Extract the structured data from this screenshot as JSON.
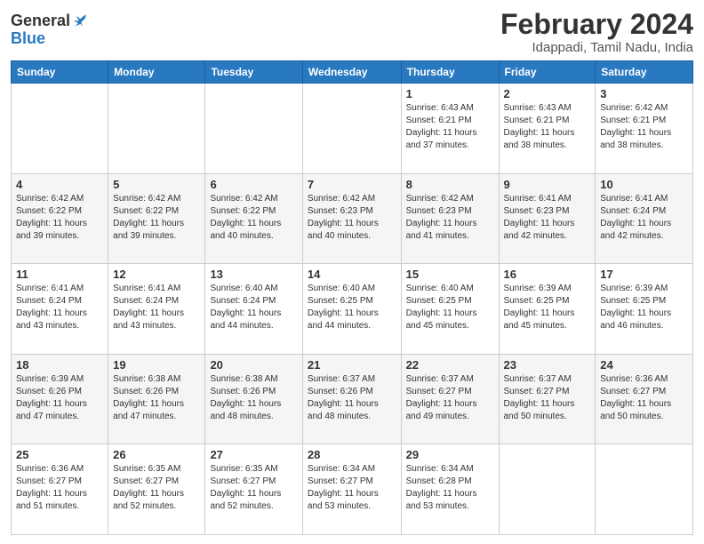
{
  "header": {
    "logo_line1": "General",
    "logo_line2": "Blue",
    "title": "February 2024",
    "subtitle": "Idappadi, Tamil Nadu, India"
  },
  "days_of_week": [
    "Sunday",
    "Monday",
    "Tuesday",
    "Wednesday",
    "Thursday",
    "Friday",
    "Saturday"
  ],
  "weeks": [
    [
      {
        "day": "",
        "info": ""
      },
      {
        "day": "",
        "info": ""
      },
      {
        "day": "",
        "info": ""
      },
      {
        "day": "",
        "info": ""
      },
      {
        "day": "1",
        "info": "Sunrise: 6:43 AM\nSunset: 6:21 PM\nDaylight: 11 hours\nand 37 minutes."
      },
      {
        "day": "2",
        "info": "Sunrise: 6:43 AM\nSunset: 6:21 PM\nDaylight: 11 hours\nand 38 minutes."
      },
      {
        "day": "3",
        "info": "Sunrise: 6:42 AM\nSunset: 6:21 PM\nDaylight: 11 hours\nand 38 minutes."
      }
    ],
    [
      {
        "day": "4",
        "info": "Sunrise: 6:42 AM\nSunset: 6:22 PM\nDaylight: 11 hours\nand 39 minutes."
      },
      {
        "day": "5",
        "info": "Sunrise: 6:42 AM\nSunset: 6:22 PM\nDaylight: 11 hours\nand 39 minutes."
      },
      {
        "day": "6",
        "info": "Sunrise: 6:42 AM\nSunset: 6:22 PM\nDaylight: 11 hours\nand 40 minutes."
      },
      {
        "day": "7",
        "info": "Sunrise: 6:42 AM\nSunset: 6:23 PM\nDaylight: 11 hours\nand 40 minutes."
      },
      {
        "day": "8",
        "info": "Sunrise: 6:42 AM\nSunset: 6:23 PM\nDaylight: 11 hours\nand 41 minutes."
      },
      {
        "day": "9",
        "info": "Sunrise: 6:41 AM\nSunset: 6:23 PM\nDaylight: 11 hours\nand 42 minutes."
      },
      {
        "day": "10",
        "info": "Sunrise: 6:41 AM\nSunset: 6:24 PM\nDaylight: 11 hours\nand 42 minutes."
      }
    ],
    [
      {
        "day": "11",
        "info": "Sunrise: 6:41 AM\nSunset: 6:24 PM\nDaylight: 11 hours\nand 43 minutes."
      },
      {
        "day": "12",
        "info": "Sunrise: 6:41 AM\nSunset: 6:24 PM\nDaylight: 11 hours\nand 43 minutes."
      },
      {
        "day": "13",
        "info": "Sunrise: 6:40 AM\nSunset: 6:24 PM\nDaylight: 11 hours\nand 44 minutes."
      },
      {
        "day": "14",
        "info": "Sunrise: 6:40 AM\nSunset: 6:25 PM\nDaylight: 11 hours\nand 44 minutes."
      },
      {
        "day": "15",
        "info": "Sunrise: 6:40 AM\nSunset: 6:25 PM\nDaylight: 11 hours\nand 45 minutes."
      },
      {
        "day": "16",
        "info": "Sunrise: 6:39 AM\nSunset: 6:25 PM\nDaylight: 11 hours\nand 45 minutes."
      },
      {
        "day": "17",
        "info": "Sunrise: 6:39 AM\nSunset: 6:25 PM\nDaylight: 11 hours\nand 46 minutes."
      }
    ],
    [
      {
        "day": "18",
        "info": "Sunrise: 6:39 AM\nSunset: 6:26 PM\nDaylight: 11 hours\nand 47 minutes."
      },
      {
        "day": "19",
        "info": "Sunrise: 6:38 AM\nSunset: 6:26 PM\nDaylight: 11 hours\nand 47 minutes."
      },
      {
        "day": "20",
        "info": "Sunrise: 6:38 AM\nSunset: 6:26 PM\nDaylight: 11 hours\nand 48 minutes."
      },
      {
        "day": "21",
        "info": "Sunrise: 6:37 AM\nSunset: 6:26 PM\nDaylight: 11 hours\nand 48 minutes."
      },
      {
        "day": "22",
        "info": "Sunrise: 6:37 AM\nSunset: 6:27 PM\nDaylight: 11 hours\nand 49 minutes."
      },
      {
        "day": "23",
        "info": "Sunrise: 6:37 AM\nSunset: 6:27 PM\nDaylight: 11 hours\nand 50 minutes."
      },
      {
        "day": "24",
        "info": "Sunrise: 6:36 AM\nSunset: 6:27 PM\nDaylight: 11 hours\nand 50 minutes."
      }
    ],
    [
      {
        "day": "25",
        "info": "Sunrise: 6:36 AM\nSunset: 6:27 PM\nDaylight: 11 hours\nand 51 minutes."
      },
      {
        "day": "26",
        "info": "Sunrise: 6:35 AM\nSunset: 6:27 PM\nDaylight: 11 hours\nand 52 minutes."
      },
      {
        "day": "27",
        "info": "Sunrise: 6:35 AM\nSunset: 6:27 PM\nDaylight: 11 hours\nand 52 minutes."
      },
      {
        "day": "28",
        "info": "Sunrise: 6:34 AM\nSunset: 6:27 PM\nDaylight: 11 hours\nand 53 minutes."
      },
      {
        "day": "29",
        "info": "Sunrise: 6:34 AM\nSunset: 6:28 PM\nDaylight: 11 hours\nand 53 minutes."
      },
      {
        "day": "",
        "info": ""
      },
      {
        "day": "",
        "info": ""
      }
    ]
  ]
}
